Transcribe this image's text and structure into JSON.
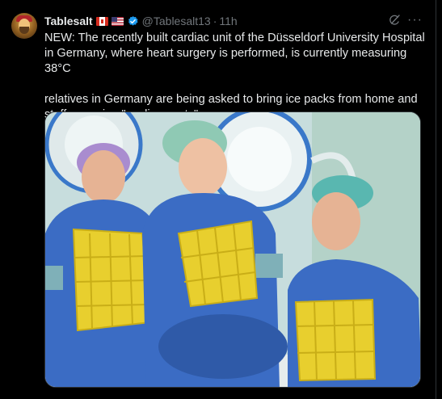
{
  "post": {
    "display_name": "Tablesalt",
    "flags": [
      "canada-flag",
      "us-flag"
    ],
    "handle": "@Tablesalt13",
    "separator": "·",
    "time": "11h",
    "paragraphs": [
      "NEW: The recently built cardiac unit of the Düsseldorf University Hospital in Germany, where heart surgery is performed, is currently measuring 38°C",
      "relatives in Germany are being asked to bring ice packs from home and staff are using \"cooling vests\""
    ],
    "more_label": "···"
  },
  "icons": {
    "verified": "verified-badge-icon",
    "grok": "grok-icon",
    "more": "more-icon"
  },
  "colors": {
    "background": "#000000",
    "text": "#e7e9ea",
    "secondary": "#71767b",
    "verified": "#1d9bf0",
    "scrub_blue": "#3b6cc4",
    "vest_yellow": "#e8cf2e"
  }
}
